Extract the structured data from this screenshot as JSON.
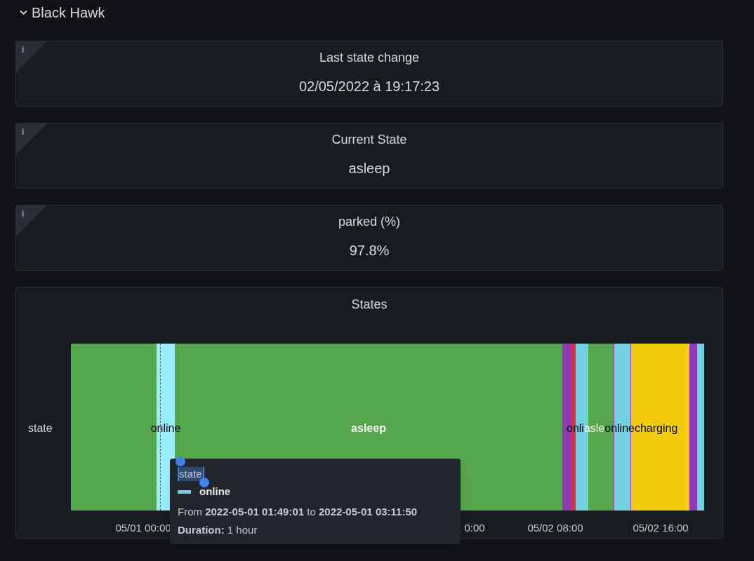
{
  "row": {
    "title": "Black Hawk",
    "expanded": true
  },
  "stats": [
    {
      "title": "Last state change",
      "value": "02/05/2022 à 19:17:23",
      "info": "i"
    },
    {
      "title": "Current State",
      "value": "asleep",
      "info": "i"
    },
    {
      "title": "parked (%)",
      "value": "97.8%",
      "info": "i"
    }
  ],
  "timeline": {
    "title": "States",
    "row_label": "state",
    "segments": [
      {
        "color": "#56a64b",
        "selected": false
      },
      {
        "color": "#8ad8e8",
        "selected": true,
        "label": "online"
      },
      {
        "color": "#56a64b",
        "selected": false,
        "label": "asleep"
      },
      {
        "color": "#8f3bb8",
        "selected": false
      },
      {
        "color": "#e02f44",
        "selected": false
      },
      {
        "color": "#73d1e3",
        "selected": false,
        "label": "onli"
      },
      {
        "color": "#56a64b",
        "selected": false,
        "label": "asle"
      },
      {
        "color": "#8f3bb8",
        "selected": false
      },
      {
        "color": "#73d1e3",
        "selected": false,
        "label": "online"
      },
      {
        "color": "#8f3bb8",
        "selected": false
      },
      {
        "color": "#f2cc0c",
        "selected": false,
        "label": "charging"
      },
      {
        "color": "#8f3bb8",
        "selected": false
      },
      {
        "color": "#73d1e3",
        "selected": false
      }
    ],
    "xticks": [
      "05/01 00:00",
      "0:00",
      "05/02 08:00",
      "05/02 16:00"
    ],
    "tooltip": {
      "series": "state",
      "value": "online",
      "color": "#73d1e3",
      "range": "From **2022-05-01 01:49:01** to **2022-05-01 03:11:50**",
      "duration": "**Duration:** 1 hour"
    }
  }
}
